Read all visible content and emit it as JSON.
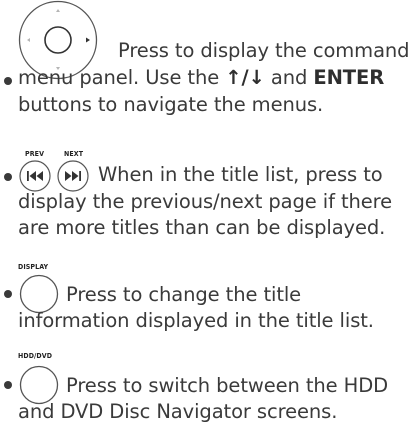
{
  "item1": {
    "line1": "Press to display the command",
    "line2_pre": "menu panel. Use the ",
    "arrows": "↑/↓",
    "line2_mid": " and ",
    "enter": "ENTER",
    "line3": "buttons to navigate the menus."
  },
  "item2": {
    "prev_label": "PREV",
    "next_label": "NEXT",
    "line1": "When in the title list, press to",
    "line2": "display the previous/next page if there",
    "line3": "are more titles than can be displayed."
  },
  "item3": {
    "label": "DISPLAY",
    "line1": "Press to change the title",
    "line2": "information displayed in the title list."
  },
  "item4": {
    "label": "HDD/DVD",
    "line1": "Press to switch between the HDD",
    "line2": "and DVD Disc Navigator screens."
  }
}
